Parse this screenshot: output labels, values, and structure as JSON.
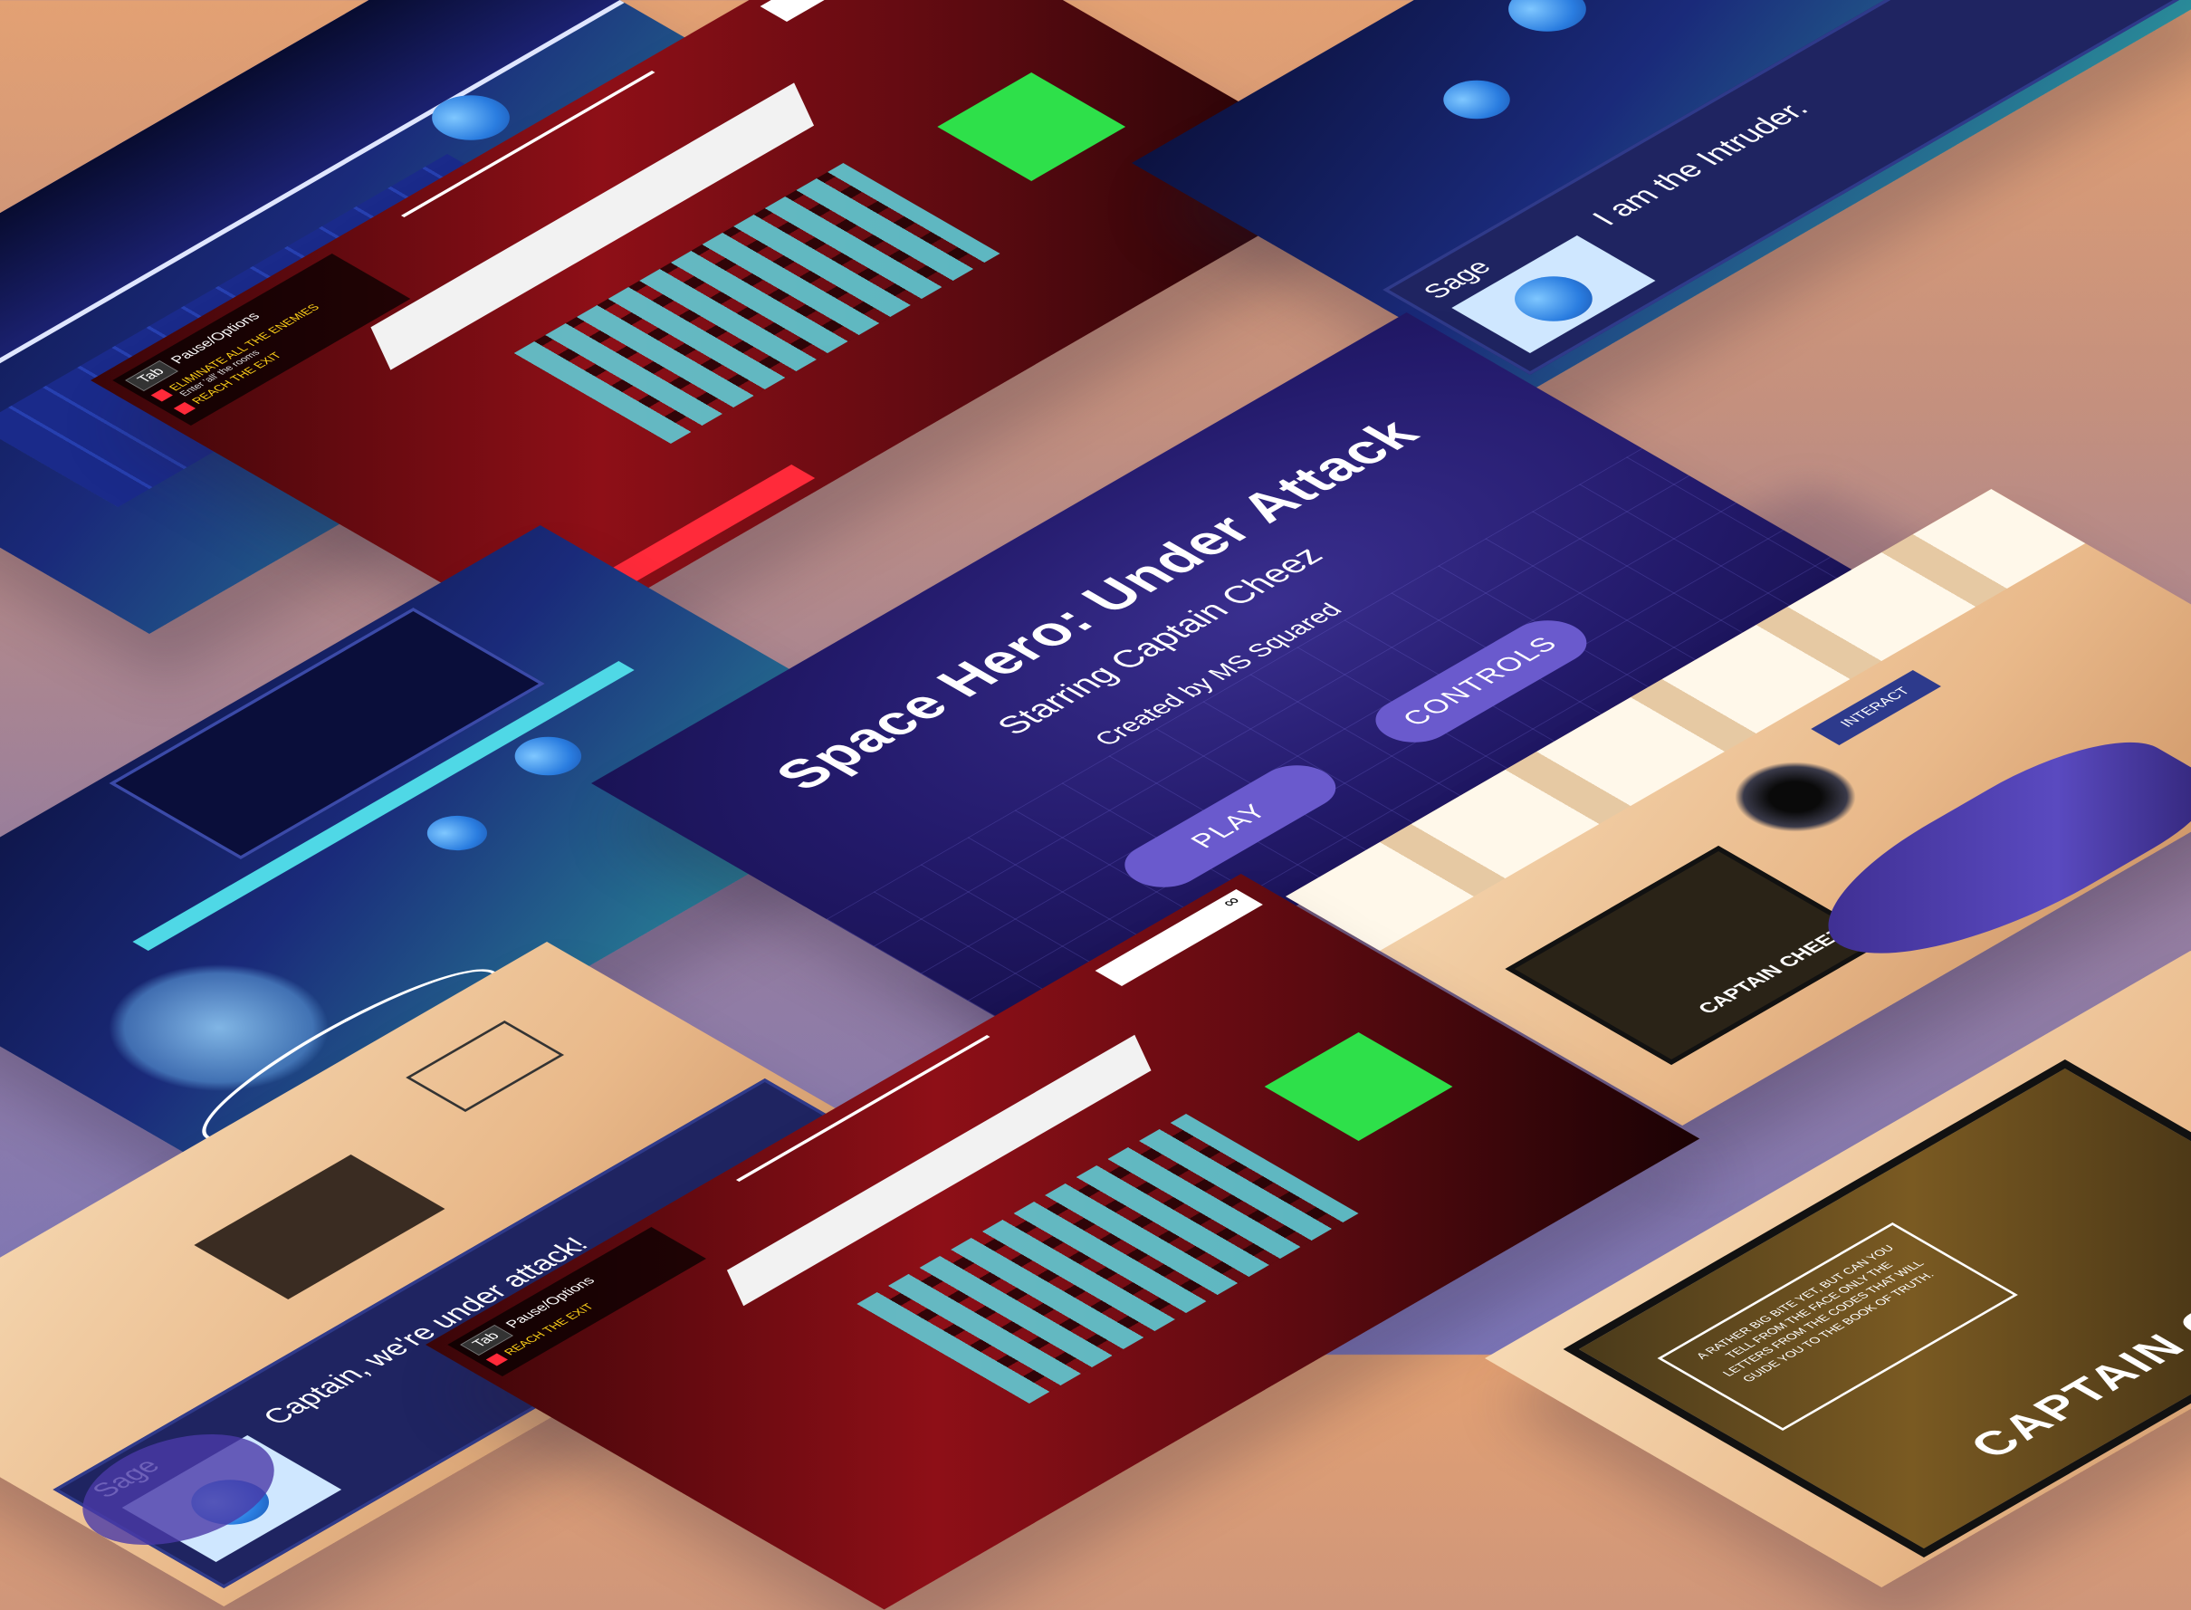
{
  "title_screen": {
    "title": "Space Hero: Under Attack",
    "subtitle": "Starring Captain Cheez",
    "credit": "Created by MS Squared",
    "play_label": "PLAY",
    "controls_label": "CONTROLS"
  },
  "dialog_intruder": {
    "speaker": "Sage",
    "line": "I am the Intruder."
  },
  "dialog_attack": {
    "speaker": "Sage",
    "line": "Captain, we're under attack!"
  },
  "hud_top": {
    "tab_key": "Tab",
    "tab_label": "Pause/Options",
    "objective_1": "ELIMINATE ALL THE ENEMIES",
    "objective_1_note": "Enter 'all' the rooms",
    "objective_2": "REACH THE EXIT",
    "ammo": "∞"
  },
  "hud_bottom": {
    "tab_key": "Tab",
    "tab_label": "Pause/Options",
    "objective_1": "REACH THE EXIT",
    "ammo": "∞"
  },
  "interact": {
    "label": "INTERACT"
  },
  "poster": {
    "brand": "CAPTAIN CHEEZ",
    "quote": "A RATHER BIG BITE YET, BUT CAN YOU TELL FROM THE FACE ONLY THE LETTERS FROM THE CODES THAT WILL GUIDE YOU TO THE BOOK OF TRUTH."
  },
  "poster_small": {
    "brand": "CAPTAIN CHEEZ"
  },
  "colors": {
    "accent_purple": "#6a5acd",
    "dialog_navy": "#1f2461",
    "hud_red": "#ff2a3a",
    "hud_yellow": "#ffd21a"
  }
}
